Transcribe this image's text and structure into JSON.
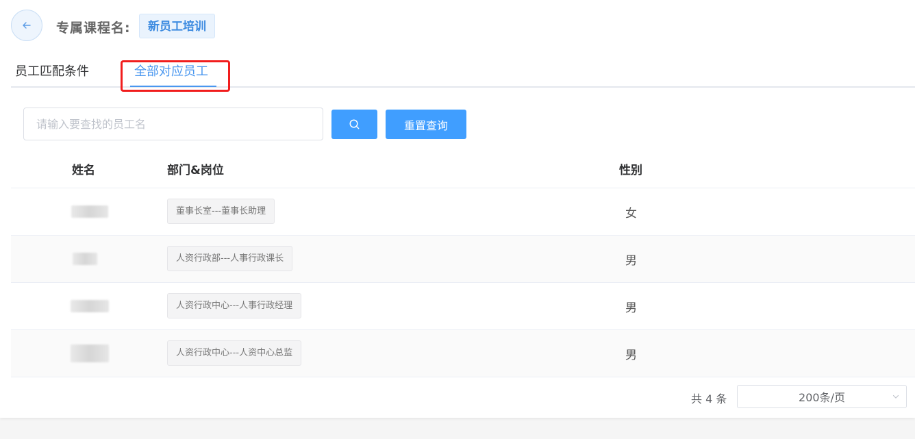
{
  "header": {
    "course_label": "专属课程名:",
    "course_name": "新员工培训"
  },
  "tabs": [
    {
      "label": "员工匹配条件",
      "active": false
    },
    {
      "label": "全部对应员工",
      "active": true
    }
  ],
  "search": {
    "placeholder": "请输入要查找的员工名",
    "value": "",
    "reset_label": "重置查询"
  },
  "table": {
    "columns": {
      "name": "姓名",
      "dept": "部门&岗位",
      "gender": "性别"
    },
    "rows": [
      {
        "dept": "董事长室---董事长助理",
        "gender": "女"
      },
      {
        "dept": "人资行政部---人事行政课长",
        "gender": "男"
      },
      {
        "dept": "人资行政中心---人事行政经理",
        "gender": "男"
      },
      {
        "dept": "人资行政中心---人资中心总监",
        "gender": "男"
      }
    ]
  },
  "pagination": {
    "total": "共 4 条",
    "page_size": "200条/页"
  },
  "colors": {
    "accent": "#409eff",
    "highlight": "#f11d1d"
  },
  "icons": {
    "back": "arrow-left-icon",
    "search": "search-icon",
    "dropdown": "chevron-down-icon"
  }
}
